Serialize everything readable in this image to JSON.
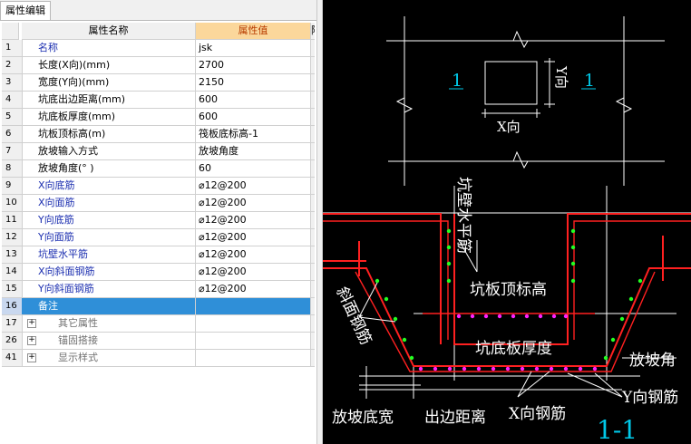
{
  "tab": {
    "title": "属性编辑"
  },
  "table": {
    "header": {
      "name_col": "属性名称",
      "value_col": "属性值",
      "extra_col": "附"
    },
    "rows": [
      {
        "num": "1",
        "name": "名称",
        "value": "jsk",
        "style": "blue"
      },
      {
        "num": "2",
        "name": "长度(X向)(mm)",
        "value": "2700",
        "style": ""
      },
      {
        "num": "3",
        "name": "宽度(Y向)(mm)",
        "value": "2150",
        "style": ""
      },
      {
        "num": "4",
        "name": "坑底出边距离(mm)",
        "value": "600",
        "style": ""
      },
      {
        "num": "5",
        "name": "坑底板厚度(mm)",
        "value": "600",
        "style": ""
      },
      {
        "num": "6",
        "name": "坑板顶标高(m)",
        "value": "筏板底标高-1",
        "style": ""
      },
      {
        "num": "7",
        "name": "放坡输入方式",
        "value": "放坡角度",
        "style": ""
      },
      {
        "num": "8",
        "name": "放坡角度(° )",
        "value": "60",
        "style": ""
      },
      {
        "num": "9",
        "name": "X向底筋",
        "value": "⌀12@200",
        "style": "blue"
      },
      {
        "num": "10",
        "name": "X向面筋",
        "value": "⌀12@200",
        "style": "blue"
      },
      {
        "num": "11",
        "name": "Y向底筋",
        "value": "⌀12@200",
        "style": "blue"
      },
      {
        "num": "12",
        "name": "Y向面筋",
        "value": "⌀12@200",
        "style": "blue"
      },
      {
        "num": "13",
        "name": "坑壁水平筋",
        "value": "⌀12@200",
        "style": "blue"
      },
      {
        "num": "14",
        "name": "X向斜面钢筋",
        "value": "⌀12@200",
        "style": "blue"
      },
      {
        "num": "15",
        "name": "Y向斜面钢筋",
        "value": "⌀12@200",
        "style": "blue"
      },
      {
        "num": "16",
        "name": "备注",
        "value": "",
        "style": "selected"
      }
    ],
    "groups": [
      {
        "num": "17",
        "name": "其它属性",
        "toggle": "+"
      },
      {
        "num": "26",
        "name": "锚固搭接",
        "toggle": "+"
      },
      {
        "num": "41",
        "name": "显示样式",
        "toggle": "+"
      }
    ]
  },
  "cad": {
    "plan_label_left": "1",
    "plan_label_right": "1",
    "plan_x_dim": "X向",
    "plan_y_dim": "Y向",
    "wall_rebar": "坑壁水平筋",
    "slab_top_elev": "坑板顶标高",
    "slope_rebar": "斜面钢筋",
    "slab_thickness": "坑底板厚度",
    "slope_angle": "放坡角",
    "y_rebar": "Y向钢筋",
    "x_rebar": "X向钢筋",
    "slope_base_width": "放坡底宽",
    "edge_distance": "出边距离",
    "section_title": "1-1",
    "colors": {
      "background": "#000000",
      "line": "#ffffff",
      "concrete": "#ff2020",
      "rebar_dot_green": "#22ff22",
      "rebar_dot_magenta": "#ff22ff",
      "cyan_label": "#00c8e8"
    }
  }
}
